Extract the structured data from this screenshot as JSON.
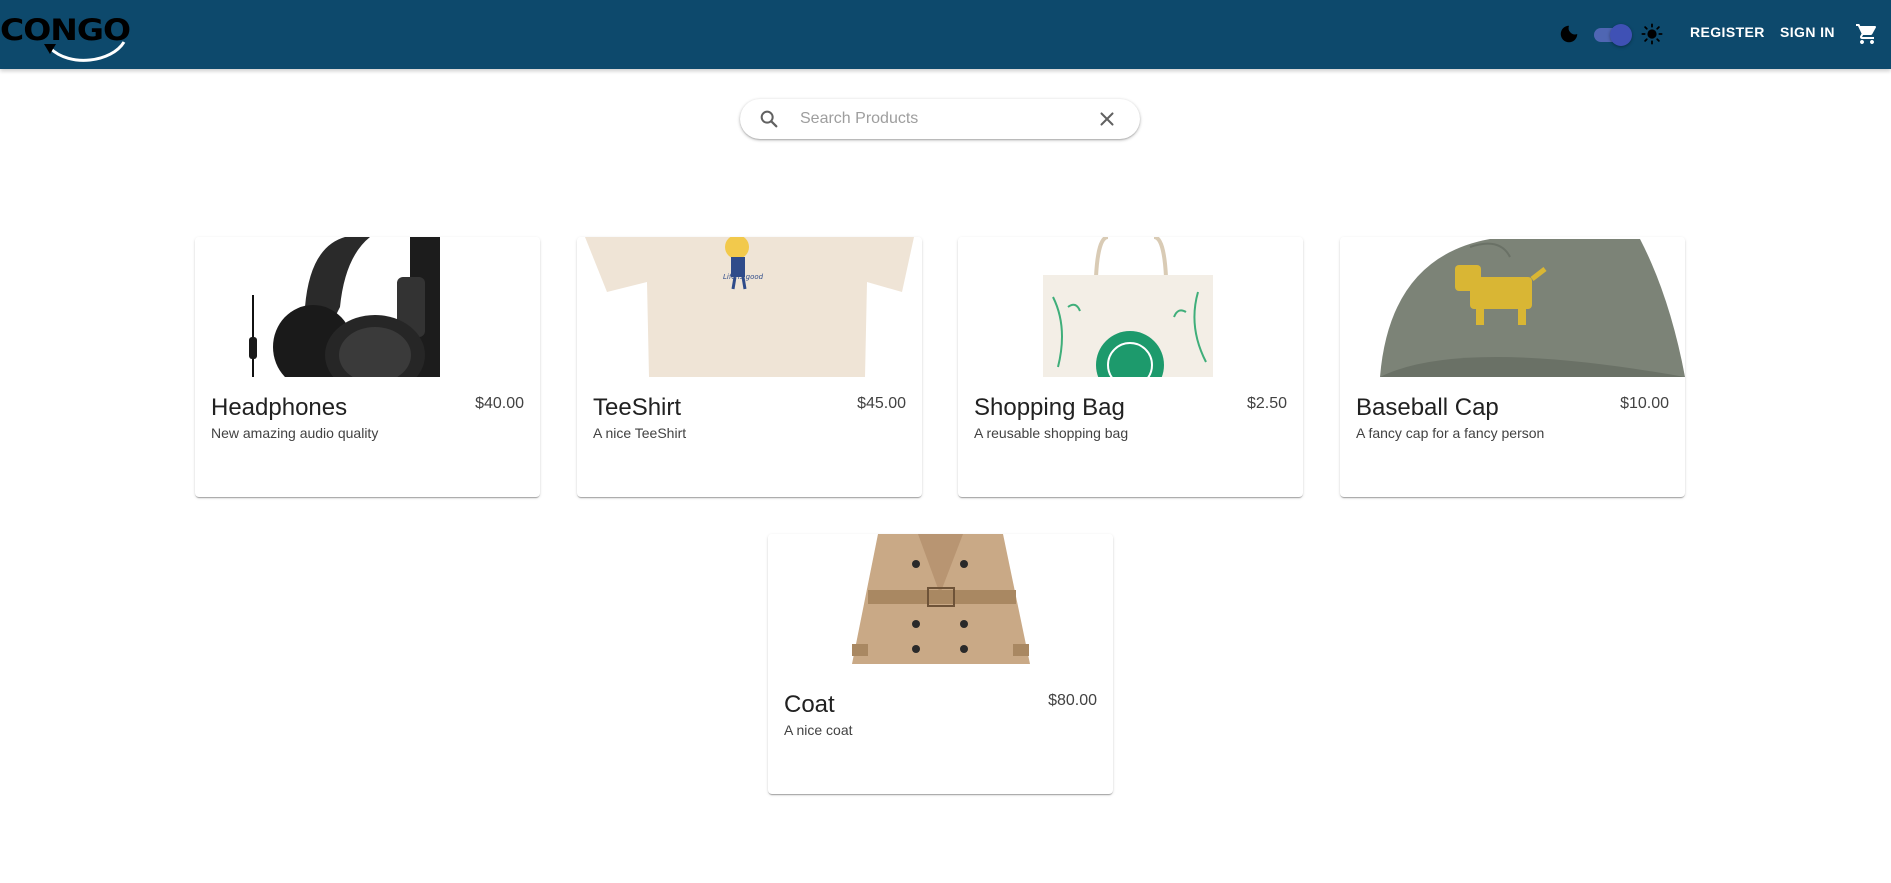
{
  "appbar": {
    "logo_text": "CONGO",
    "theme_moon_icon": "moon-icon",
    "theme_sun_icon": "sun-icon",
    "register_label": "REGISTER",
    "signin_label": "SIGN IN",
    "cart_icon": "cart-icon",
    "background_color": "#0d496c"
  },
  "search": {
    "placeholder": "Search Products",
    "value": "",
    "search_icon": "search-icon",
    "clear_icon": "close-icon"
  },
  "products": [
    {
      "title": "Headphones",
      "price": "$40.00",
      "description": "New amazing audio quality"
    },
    {
      "title": "TeeShirt",
      "price": "$45.00",
      "description": "A nice TeeShirt"
    },
    {
      "title": "Shopping Bag",
      "price": "$2.50",
      "description": "A reusable shopping bag"
    },
    {
      "title": "Baseball Cap",
      "price": "$10.00",
      "description": "A fancy cap for a fancy person"
    },
    {
      "title": "Coat",
      "price": "$80.00",
      "description": "A nice coat"
    }
  ],
  "tshirt_print_text": "Life is good"
}
